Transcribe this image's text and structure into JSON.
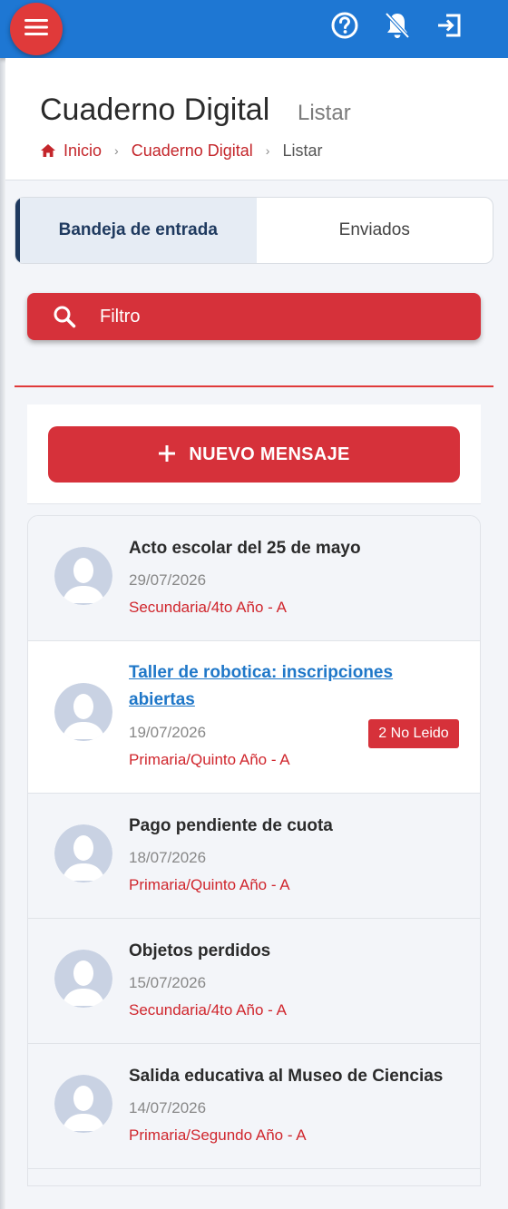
{
  "topbar": {
    "menu_icon": "hamburger-icon",
    "help_icon": "help-circle-icon",
    "notifications_icon": "bell-off-icon",
    "logout_icon": "logout-icon",
    "color": "#1e77d3"
  },
  "header": {
    "title": "Cuaderno Digital",
    "subtitle": "Listar"
  },
  "breadcrumb": {
    "home_icon": "home-icon",
    "items": [
      "Inicio",
      "Cuaderno Digital",
      "Listar"
    ]
  },
  "tabs": [
    {
      "label": "Bandeja de entrada",
      "active": true
    },
    {
      "label": "Enviados",
      "active": false
    }
  ],
  "filter": {
    "label": "Filtro",
    "icon": "search-icon"
  },
  "new_message": {
    "label": "NUEVO MENSAJE",
    "icon": "plus-icon"
  },
  "messages": [
    {
      "title": "Acto escolar del 25 de mayo",
      "date": "29/07/2026",
      "group": "Secundaria/4to Año - A",
      "badge": ""
    },
    {
      "title": "Taller de robotica: inscripciones abiertas",
      "date": "19/07/2026",
      "group": "Primaria/Quinto Año - A",
      "badge": "2 No Leido"
    },
    {
      "title": "Pago pendiente de cuota",
      "date": "18/07/2026",
      "group": "Primaria/Quinto Año - A",
      "badge": ""
    },
    {
      "title": "Objetos perdidos",
      "date": "15/07/2026",
      "group": "Secundaria/4to Año - A",
      "badge": ""
    },
    {
      "title": "Salida educativa al Museo de Ciencias",
      "date": "14/07/2026",
      "group": "Primaria/Segundo Año - A",
      "badge": ""
    }
  ],
  "colors": {
    "accent_red": "#d6313a",
    "link_blue": "#1f77c8",
    "tab_active": "#1f3a5f"
  }
}
